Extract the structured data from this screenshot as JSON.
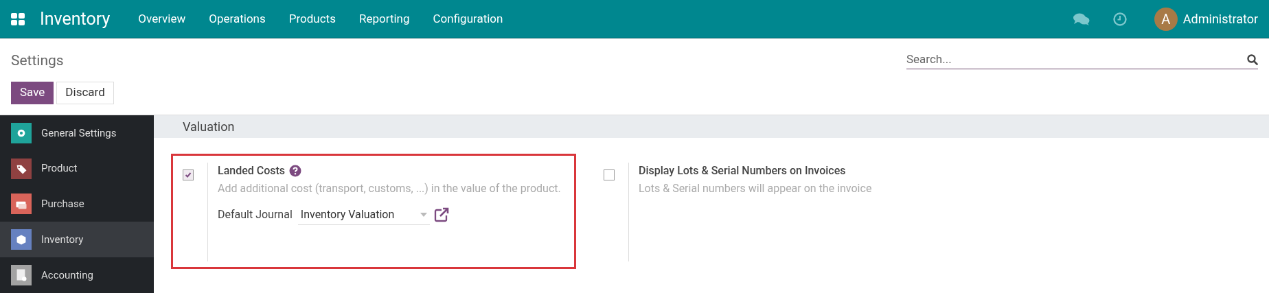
{
  "navbar": {
    "app_name": "Inventory",
    "menu": [
      "Overview",
      "Operations",
      "Products",
      "Reporting",
      "Configuration"
    ],
    "user": {
      "initial": "A",
      "name": "Administrator"
    }
  },
  "control_panel": {
    "title": "Settings",
    "search": {
      "placeholder": "Search..."
    },
    "buttons": [
      {
        "label": "Save",
        "kind": "primary"
      },
      {
        "label": "Discard",
        "kind": "secondary"
      }
    ]
  },
  "sidebar": {
    "items": [
      {
        "label": "General Settings",
        "color": "#1fa39a",
        "selected": false
      },
      {
        "label": "Product",
        "color": "#8f4141",
        "selected": false
      },
      {
        "label": "Purchase",
        "color": "#d9645a",
        "selected": false
      },
      {
        "label": "Inventory",
        "color": "#6681c0",
        "selected": true
      },
      {
        "label": "Accounting",
        "color": "#a3a3a3",
        "selected": false
      }
    ]
  },
  "section": {
    "title": "Valuation",
    "settings": [
      {
        "title": "Landed Costs",
        "checked": true,
        "help": true,
        "highlighted": true,
        "description": "Add additional cost (transport, customs, ...) in the value of the product.",
        "field": {
          "label": "Default Journal",
          "value": "Inventory Valuation"
        }
      },
      {
        "title": "Display Lots & Serial Numbers on Invoices",
        "checked": false,
        "help": false,
        "highlighted": false,
        "description": "Lots & Serial numbers will appear on the invoice"
      }
    ]
  }
}
